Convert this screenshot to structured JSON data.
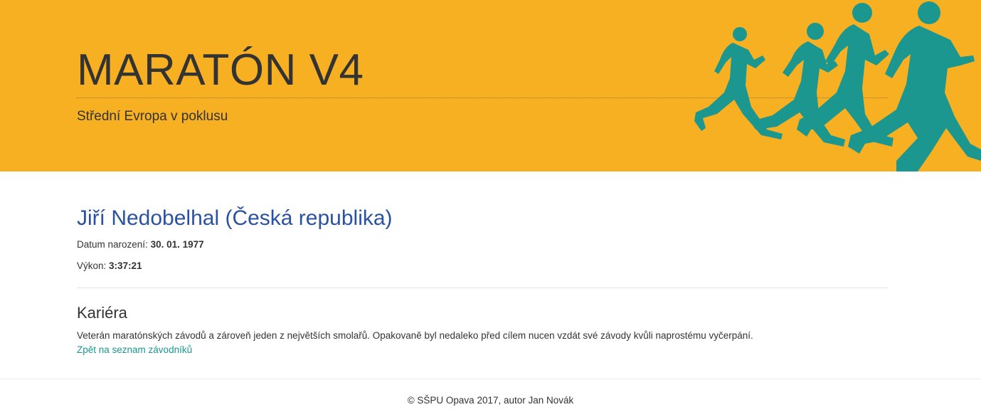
{
  "header": {
    "title": "MARATÓN V4",
    "subtitle": "Střední Evropa v poklusu",
    "background_color": "#f6b022",
    "illustration": "runners-silhouette",
    "illustration_color": "#1b9790"
  },
  "runner": {
    "heading": "Jiří Nedobelhal (Česká republika)",
    "birth_label": "Datum narození:",
    "birth_value": "30. 01. 1977",
    "performance_label": "Výkon:",
    "performance_value": "3:37:21"
  },
  "career": {
    "heading": "Kariéra",
    "text": "Veterán maratónských závodů a zároveň jeden z největších smolařů. Opakovaně byl nedaleko před cílem nucen vzdát své závody kvůli naprostému vyčerpání.",
    "back_link": "Zpět na seznam závodníků"
  },
  "footer": {
    "text": "© SŠPU Opava 2017, autor Jan Novák"
  },
  "colors": {
    "link": "#1b9790",
    "heading_blue": "#2a52a0"
  }
}
